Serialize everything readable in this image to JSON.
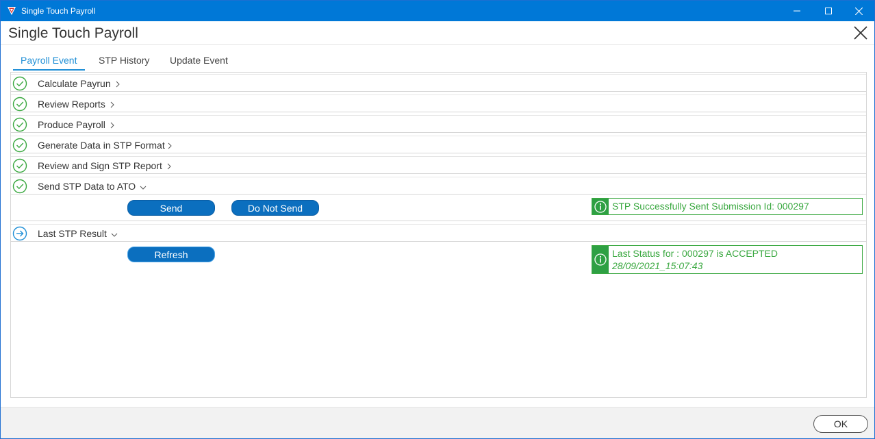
{
  "window": {
    "title": "Single Touch Payroll"
  },
  "header": {
    "title": "Single Touch Payroll"
  },
  "tabs": [
    {
      "label": "Payroll Event",
      "active": true
    },
    {
      "label": "STP History",
      "active": false
    },
    {
      "label": "Update Event",
      "active": false
    }
  ],
  "steps": [
    {
      "label": "Calculate Payrun",
      "icon": "check-circle-icon"
    },
    {
      "label": "Review Reports",
      "icon": "check-circle-icon"
    },
    {
      "label": "Produce Payroll",
      "icon": "check-circle-icon"
    },
    {
      "label": "Generate Data in STP Format",
      "icon": "check-circle-icon"
    },
    {
      "label": "Review and Sign STP Report",
      "icon": "check-circle-icon"
    },
    {
      "label": "Send STP Data to ATO",
      "icon": "check-circle-icon",
      "expanded": true
    },
    {
      "label": "Last STP Result",
      "icon": "arrow-circle-icon",
      "expanded": true
    }
  ],
  "send_panel": {
    "send_label": "Send",
    "do_not_send_label": "Do Not Send",
    "status_text": "STP Successfully Sent Submission Id: 000297"
  },
  "result_panel": {
    "refresh_label": "Refresh",
    "status_line1": "Last Status for : 000297 is ACCEPTED",
    "status_line2": "28/09/2021_15:07:43"
  },
  "footer": {
    "ok_label": "OK"
  },
  "colors": {
    "titlebar": "#0078d7",
    "accent": "#1f8fd6",
    "success": "#3aa840",
    "button": "#0b6fbf"
  }
}
